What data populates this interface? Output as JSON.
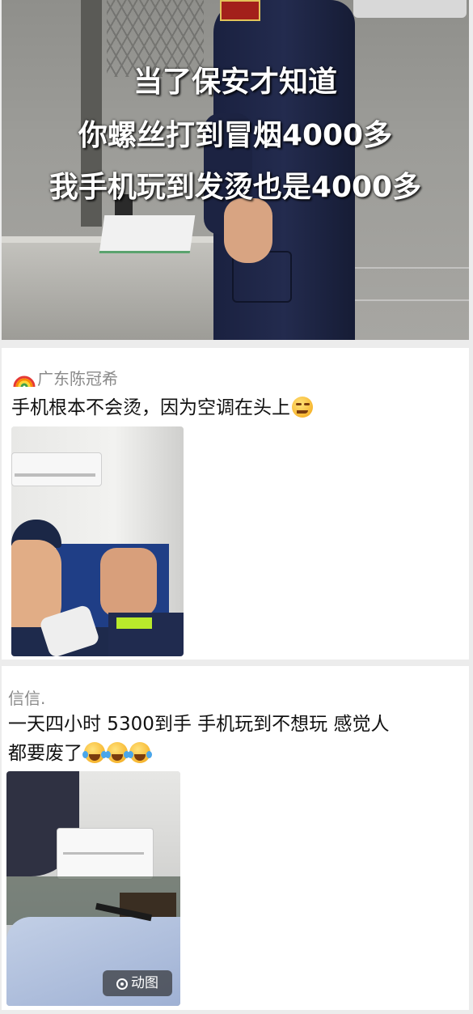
{
  "hero": {
    "captions": [
      "当了保安才知道",
      "你螺丝打到冒烟4000多",
      "我手机玩到发烫也是4000多"
    ]
  },
  "posts": [
    {
      "author": "广东陈冠希",
      "author_icon": "rainbow-icon",
      "text": "手机根本不会烫，因为空调在头上",
      "emojis": [
        "smirk-emoji"
      ],
      "photo_badge": ""
    },
    {
      "author": "信信.",
      "text_line1": "一天四小时 5300到手 手机玩到不想玩 感觉人",
      "text_line2": "都要废了",
      "emojis": [
        "laughing-crying-emoji",
        "laughing-crying-emoji",
        "laughing-crying-emoji"
      ],
      "photo_badge": "动图"
    }
  ],
  "colors": {
    "background": "#ececec",
    "card": "#ffffff",
    "author": "#8a8a8a",
    "text": "#111111"
  }
}
